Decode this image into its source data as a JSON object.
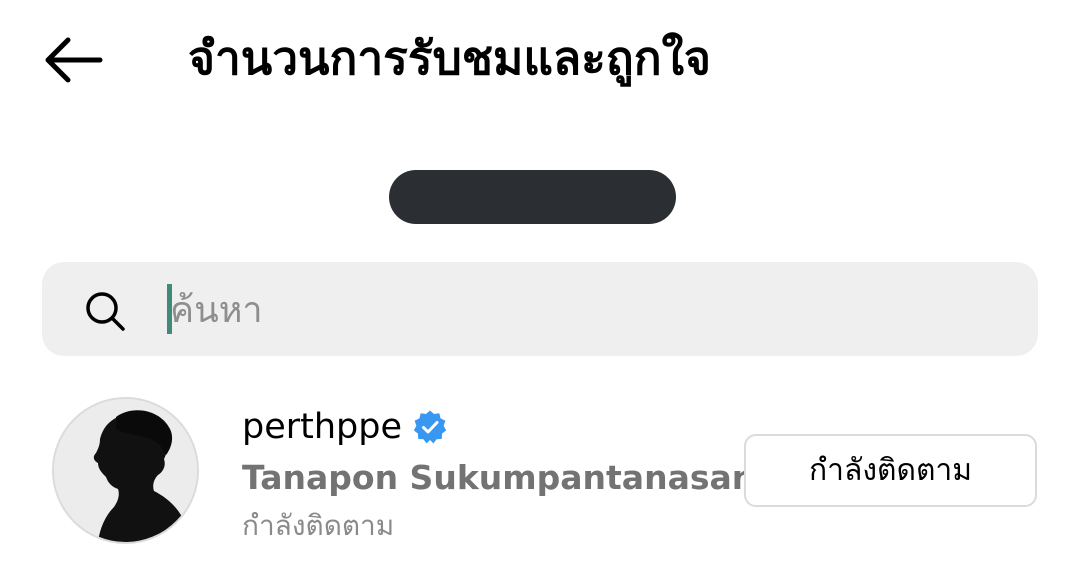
{
  "header": {
    "back_icon": "arrow-left-icon",
    "title": "จำนวนการรับชมและถูกใจ"
  },
  "search": {
    "icon": "search-icon",
    "placeholder": "ค้นหา",
    "value": ""
  },
  "users": [
    {
      "username": "perthppe",
      "verified": true,
      "verified_icon": "verified-badge-icon",
      "verified_color": "#3897f0",
      "full_name": "Tanapon Sukumpantanasan",
      "status_text": "กำลังติดตาม",
      "button_label": "กำลังติดตาม"
    }
  ],
  "colors": {
    "redacted_pill": "#2b2f33",
    "search_background": "#efefef",
    "caret": "#3f8a78",
    "secondary_text": "#737373"
  }
}
